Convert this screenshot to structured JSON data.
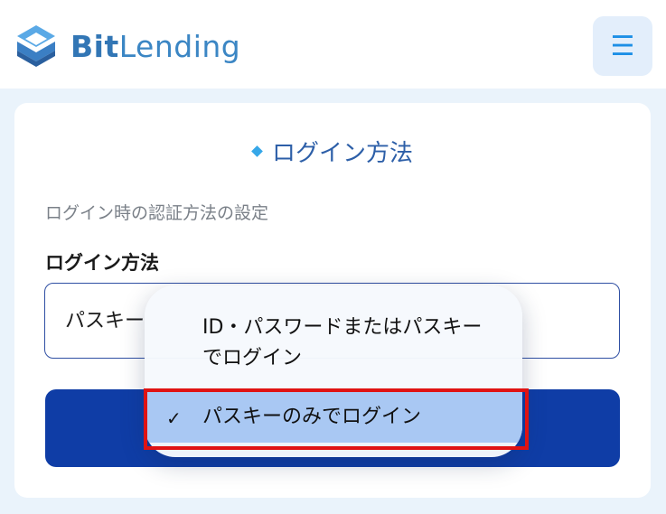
{
  "header": {
    "brand_bold": "Bit",
    "brand_light": "Lending",
    "logo_icon": "bitlending-logo-icon",
    "menu_icon_glyph": "☰"
  },
  "section": {
    "title": "ログイン方法"
  },
  "form": {
    "description": "ログイン時の認証方法の設定",
    "field_label": "ログイン方法",
    "select_value": "パスキー",
    "submit_label": ""
  },
  "dropdown": {
    "options": [
      {
        "label": "ID・パスワードまたはパスキーでログイン",
        "selected": false
      },
      {
        "label": "パスキーのみでログイン",
        "selected": true
      }
    ],
    "check_glyph": "✓"
  },
  "colors": {
    "brand": "#3276b5",
    "accent": "#1d8fe6",
    "button": "#0f3da6",
    "selected_option": "#a9c8f3",
    "highlight": "#e01313"
  }
}
